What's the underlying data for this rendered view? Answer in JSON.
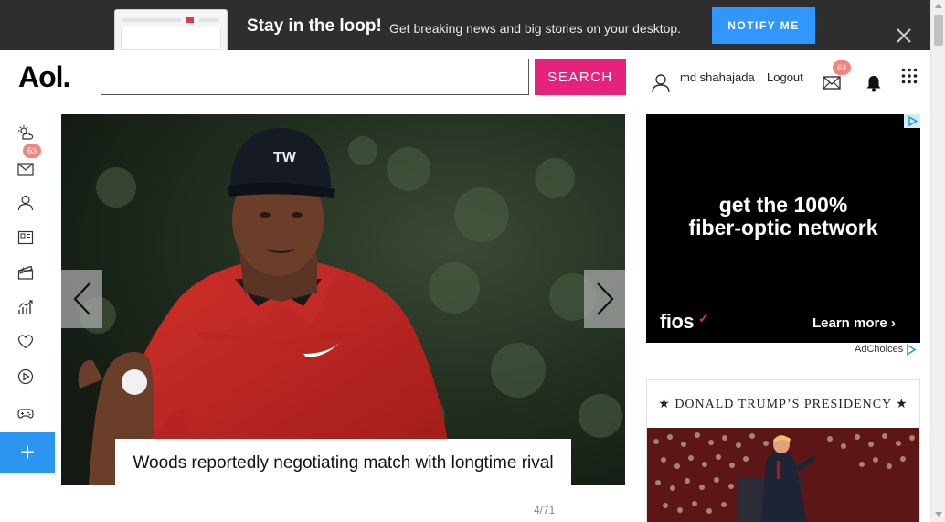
{
  "promo": {
    "title": "Stay in the loop!",
    "text": "Get breaking news and big stories on your desktop.",
    "button": "NOTIFY ME",
    "close_icon": "close-icon"
  },
  "header": {
    "logo": "Aol.",
    "search_placeholder": "",
    "search_button": "SEARCH",
    "username": "md shahajada",
    "logout": "Logout",
    "mail_badge": "63"
  },
  "rail": {
    "items": [
      {
        "name": "weather-icon"
      },
      {
        "name": "mail-icon",
        "badge": "63"
      },
      {
        "name": "profile-icon"
      },
      {
        "name": "news-icon"
      },
      {
        "name": "entertainment-icon"
      },
      {
        "name": "finance-icon"
      },
      {
        "name": "lifestyle-icon"
      },
      {
        "name": "video-icon"
      },
      {
        "name": "games-icon"
      }
    ],
    "add_label": "+"
  },
  "slideshow": {
    "caption": "Woods reportedly negotiating match with longtime rival",
    "counter": "4/71"
  },
  "ad": {
    "headline_line1": "get the 100%",
    "headline_line2": "fiber-optic network",
    "brand": "fios",
    "cta": "Learn more",
    "adchoices": "AdChoices"
  },
  "card": {
    "title": "★ DONALD TRUMP’S PRESIDENCY ★"
  },
  "colors": {
    "promo_bg": "#2e2e2e",
    "notify_blue": "#2f97ff",
    "search_pink": "#e6227d",
    "rail_add_blue": "#2b95f0",
    "badge": "#f4847e"
  }
}
